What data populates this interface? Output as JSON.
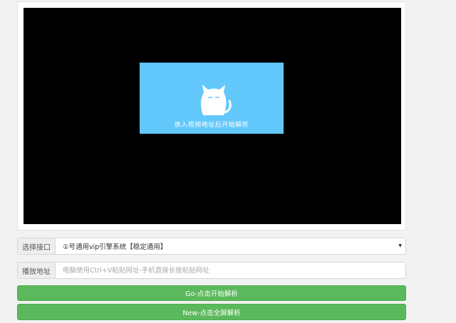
{
  "player": {
    "placeholder_text": "放入视频地址后开始解析",
    "icon": "cat-icon"
  },
  "interface_select": {
    "label": "选择接口",
    "selected": "①号通用vip引擎系统【稳定通用】"
  },
  "url_input": {
    "label": "播放地址",
    "value": "",
    "placeholder": "电脑使用Ctrl+V粘贴网址-手机直接长按粘贴网址"
  },
  "buttons": {
    "go": "Go-点击开始解析",
    "new": "New-点击全屏解析"
  },
  "colors": {
    "placeholder_bg": "#62c8fb",
    "button_green": "#5cb85c",
    "video_bg": "#000000"
  }
}
